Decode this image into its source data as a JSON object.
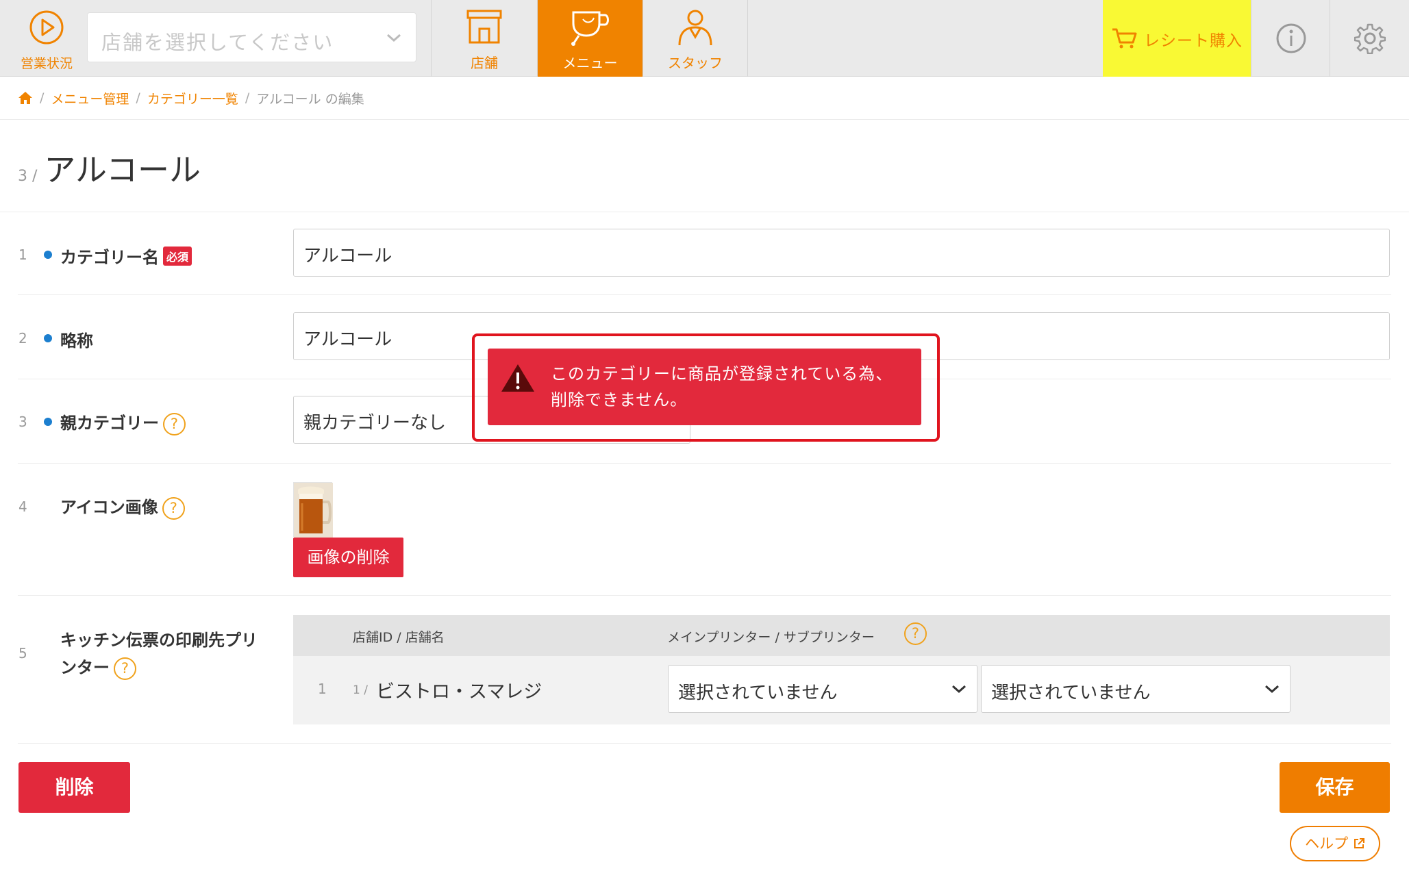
{
  "topbar": {
    "status_label": "営業状況",
    "store_select_placeholder": "店舗を選択してください",
    "tabs": [
      {
        "label": "店舗",
        "icon": "store-icon"
      },
      {
        "label": "メニュー",
        "icon": "cup-icon",
        "active": true
      },
      {
        "label": "スタッフ",
        "icon": "staff-icon"
      }
    ],
    "receipt_label": "レシート購入",
    "info_icon": "info-icon",
    "settings_icon": "gear-icon"
  },
  "breadcrumb": {
    "home_icon": "home-icon",
    "items": [
      "メニュー管理",
      "カテゴリー一覧"
    ],
    "current": "アルコール の編集"
  },
  "title": {
    "num": "3 /",
    "text": "アルコール"
  },
  "form": {
    "rows": [
      {
        "num": "1",
        "label": "カテゴリー名",
        "required": "必須",
        "value": "アルコール"
      },
      {
        "num": "2",
        "label": "略称",
        "value": "アルコール"
      },
      {
        "num": "3",
        "label": "親カテゴリー",
        "help": "?",
        "value": "親カテゴリーなし"
      },
      {
        "num": "4",
        "label": "アイコン画像",
        "help": "?",
        "delete_image": "画像の削除"
      },
      {
        "num": "5",
        "label_line1": "キッチン伝票の印刷先プリ",
        "label_line2": "ンター",
        "help": "?"
      }
    ]
  },
  "printer_table": {
    "col_store": "店舗ID / 店舗名",
    "col_printer": "メインプリンター / サブプリンター",
    "help": "?",
    "rows": [
      {
        "num": "1",
        "store_id": "1 /",
        "store_name": "ビストロ・スマレジ",
        "main": "選択されていません",
        "sub": "選択されていません"
      }
    ]
  },
  "buttons": {
    "delete": "削除",
    "save": "保存",
    "help": "ヘルプ"
  },
  "alert": {
    "message": "このカテゴリーに商品が登録されている為、\n削除できません。"
  },
  "colors": {
    "accent": "#f08300",
    "danger": "#e2293c",
    "highlight": "#f9f934",
    "required_dot": "#1c7fcf"
  }
}
